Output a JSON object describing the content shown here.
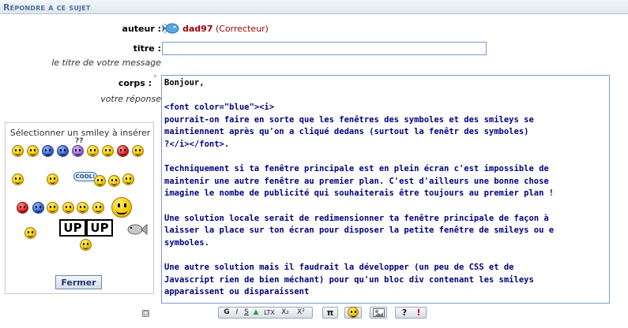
{
  "header": {
    "title": "Répondre à ce sujet"
  },
  "author": {
    "label": "auteur :",
    "name": "dad97",
    "role": "(Correcteur)"
  },
  "title_field": {
    "label": "titre :",
    "hint": "le titre de votre message",
    "value": ""
  },
  "body_field": {
    "label": "corps :",
    "hint": "votre réponse",
    "greeting": "Bonjour,",
    "content": "<font color=\"blue\"><i>\npourrait-on faire en sorte que les fenêtres des symboles et des smileys se\nmaintiennent après qu'on a cliqué dedans (surtout la fenêtr des symboles)\n?</i></font>.\n\nTechniquement si ta fenêtre principale est en plein écran c'est impossible de\nmaintenir une autre fenêtre au premier plan. C'est d'ailleurs une bonne chose\nimagine le nombe de publicité qui souhaiterais être toujours au premier plan !\n\nUne solution locale serait de redimensionner ta fenêtre principale de façon à\nlaisser la place sur ton écran pour disposer la petite fenêtre de smileys ou e\nsymboles.\n\nUne autre solution mais il faudrait la développer (un peu de CSS et de\nJavascript rien de bien méchant) pour qu'un bloc div contenant les smileys\napparaissent ou disparaissent"
  },
  "smiley_panel": {
    "title": "Sélectionner un smiley à insérer",
    "cool_text": "COOL!",
    "up_text": "UP",
    "close_label": "Fermer",
    "toggle_label": "□"
  },
  "toolbar": {
    "format_buttons": [
      "G",
      "I",
      "S",
      "▲",
      "LTX",
      "X₂",
      "X²"
    ],
    "pi_label": "π",
    "help_label": "?",
    "alert_label": "!"
  },
  "colors": {
    "accent": "#4a6f9c",
    "author": "#a00000",
    "body_text": "#000080",
    "border": "#7a9cc6"
  }
}
